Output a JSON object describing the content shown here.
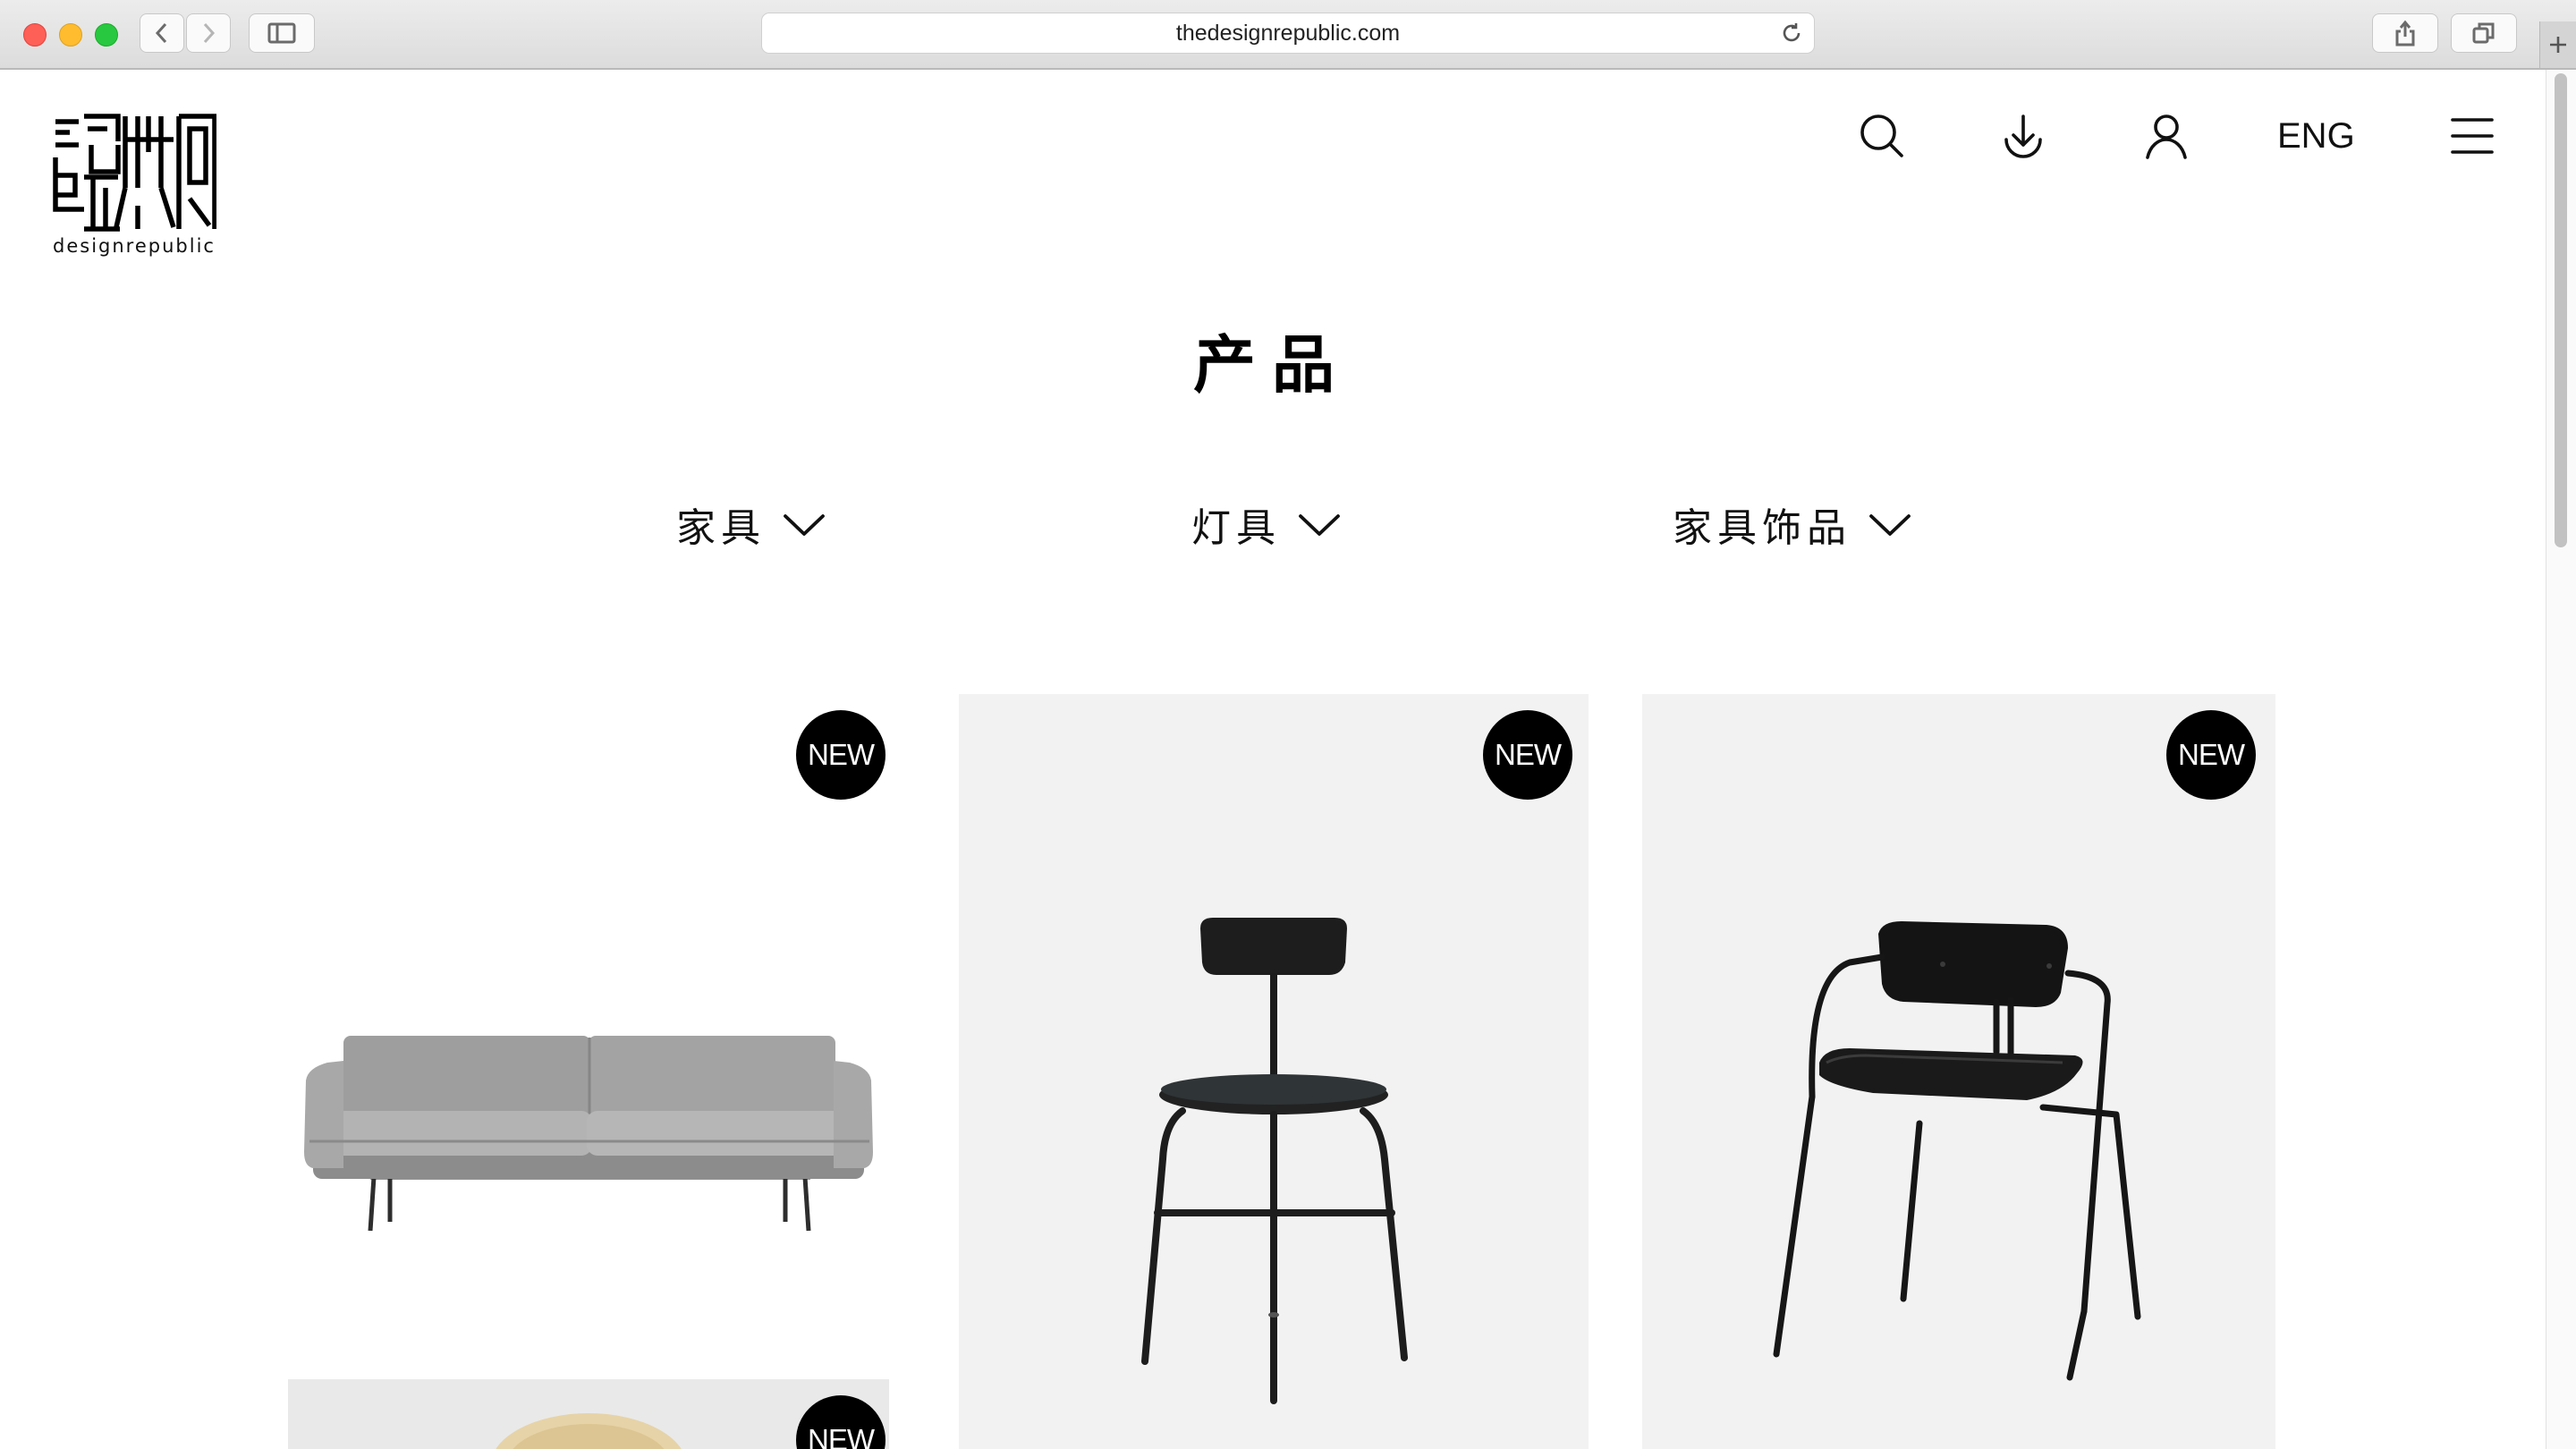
{
  "browser": {
    "url": "thedesignrepublic.com"
  },
  "header": {
    "logo_text": "designrepublic",
    "language": "ENG",
    "icons": [
      "search-icon",
      "download-icon",
      "user-icon",
      "menu-icon"
    ]
  },
  "page": {
    "title": "产品"
  },
  "filters": [
    {
      "label": "家具"
    },
    {
      "label": "灯具"
    },
    {
      "label": "家具饰品"
    }
  ],
  "products": [
    {
      "badge": "NEW",
      "image": "sofa"
    },
    {
      "badge": "NEW",
      "image": "bar-chair"
    },
    {
      "badge": "NEW",
      "image": "armchair"
    },
    {
      "badge": "NEW",
      "image": "wooden-lamp"
    }
  ],
  "colors": {
    "badge_bg": "#000000",
    "card_bg": "#f2f2f2"
  }
}
